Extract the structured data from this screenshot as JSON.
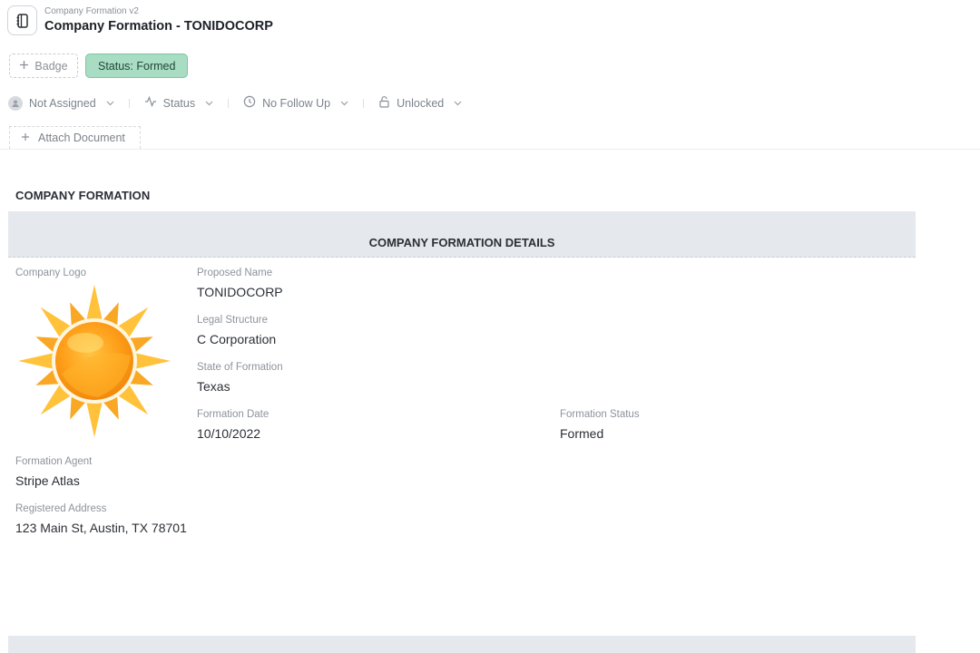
{
  "header": {
    "subtitle": "Company Formation v2",
    "title": "Company Formation - TONIDOCORP",
    "icon": "notebook-icon"
  },
  "badges": {
    "add_label": "Badge",
    "status_label": "Status: Formed",
    "status_color": "#a8dcc3"
  },
  "meta": {
    "assignee": "Not Assigned",
    "status": "Status",
    "follow_up": "No Follow Up",
    "lock": "Unlocked"
  },
  "attach_label": "Attach Document",
  "section": {
    "title": "COMPANY FORMATION",
    "band_title": "COMPANY FORMATION DETAILS"
  },
  "fields": {
    "logo_label": "Company Logo",
    "proposed_name": {
      "label": "Proposed Name",
      "value": "TONIDOCORP"
    },
    "legal_structure": {
      "label": "Legal Structure",
      "value": "C Corporation"
    },
    "state": {
      "label": "State of Formation",
      "value": "Texas"
    },
    "formation_date": {
      "label": "Formation Date",
      "value": "10/10/2022"
    },
    "formation_status": {
      "label": "Formation Status",
      "value": "Formed"
    },
    "agent": {
      "label": "Formation Agent",
      "value": "Stripe Atlas"
    },
    "address": {
      "label": "Registered Address",
      "value": "123 Main St, Austin, TX 78701"
    }
  }
}
